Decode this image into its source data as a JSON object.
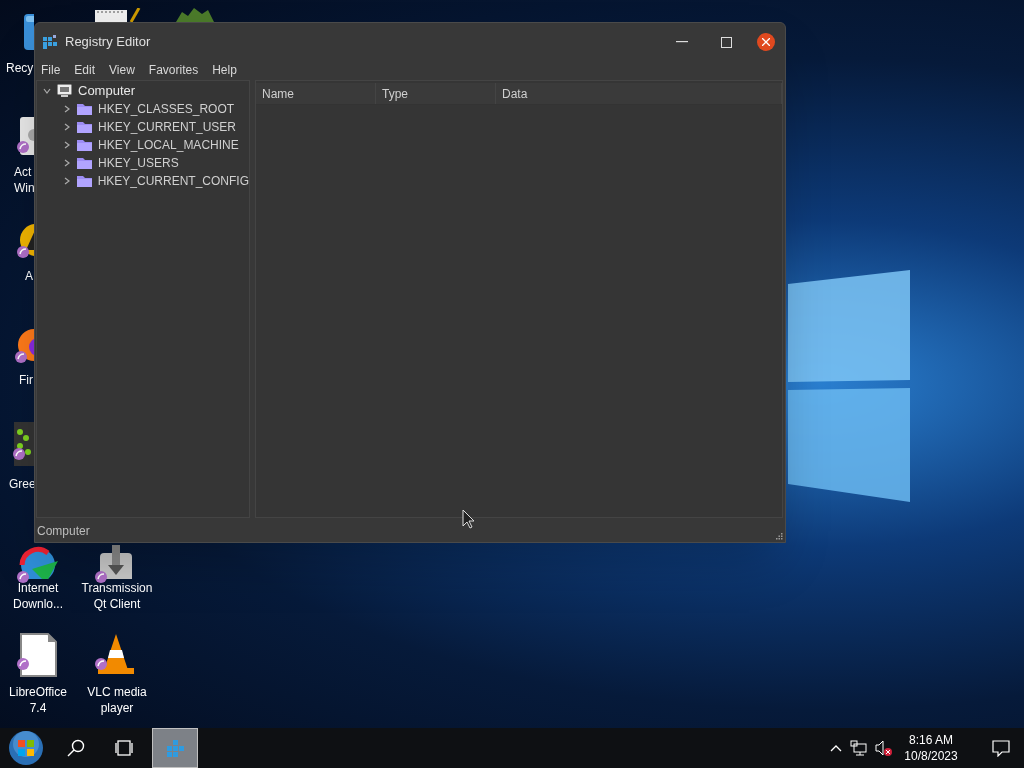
{
  "desktop_icons": [
    {
      "label": "Recy",
      "kind": "recycle",
      "shortcut": false
    },
    {
      "label": "Act Win",
      "kind": "gear",
      "shortcut": true
    },
    {
      "label": "A",
      "kind": "yellow",
      "shortcut": true
    },
    {
      "label": "Fir",
      "kind": "firefox",
      "shortcut": true
    },
    {
      "label": "Gree",
      "kind": "green",
      "shortcut": true
    },
    {
      "label": "Internet Downlo...",
      "kind": "idm",
      "shortcut": true
    },
    {
      "label": "Transmission Qt Client",
      "kind": "transmission",
      "shortcut": true
    },
    {
      "label": "LibreOffice 7.4",
      "kind": "document",
      "shortcut": true
    },
    {
      "label": "VLC media player",
      "kind": "cone",
      "shortcut": true
    }
  ],
  "window": {
    "title": "Registry Editor",
    "menu": [
      "File",
      "Edit",
      "View",
      "Favorites",
      "Help"
    ],
    "tree": [
      {
        "label": "Computer",
        "kind": "computer",
        "expanded": true,
        "children": [
          {
            "label": "HKEY_CLASSES_ROOT",
            "kind": "folder",
            "expanded": false
          },
          {
            "label": "HKEY_CURRENT_USER",
            "kind": "folder",
            "expanded": false
          },
          {
            "label": "HKEY_LOCAL_MACHINE",
            "kind": "folder",
            "expanded": false
          },
          {
            "label": "HKEY_USERS",
            "kind": "folder",
            "expanded": false
          },
          {
            "label": "HKEY_CURRENT_CONFIG",
            "kind": "folder",
            "expanded": false
          }
        ]
      }
    ],
    "columns": [
      "Name",
      "Type",
      "Data"
    ],
    "status_bar": "Computer"
  },
  "taskbar": {
    "apps": [
      {
        "kind": "regedit",
        "selected": true
      }
    ],
    "clock": {
      "time": "8:16 AM",
      "date": "10/8/2023"
    },
    "volume_muted": true
  }
}
